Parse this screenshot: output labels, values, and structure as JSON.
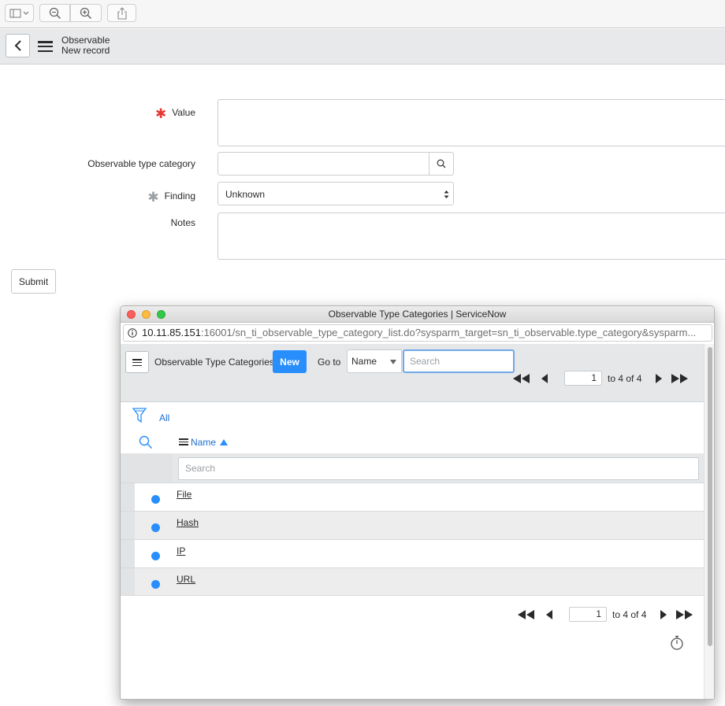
{
  "browser_toolbar": {
    "buttons": [
      "sidebar-toggle",
      "zoom-out",
      "zoom-in",
      "share"
    ]
  },
  "header": {
    "title": "Observable",
    "subtitle": "New record"
  },
  "form": {
    "value_label": "Value",
    "value_required_mark": "✱",
    "category_label": "Observable type category",
    "finding_label": "Finding",
    "finding_required_mark": "✱",
    "finding_selected": "Unknown",
    "notes_label": "Notes",
    "submit_label": "Submit"
  },
  "popup": {
    "window_title": "Observable Type Categories | ServiceNow",
    "url_host": "10.11.85.151",
    "url_rest": ":16001/sn_ti_observable_type_category_list.do?sysparm_target=sn_ti_observable.type_category&sysparm...",
    "list_title": "Observable Type Categories",
    "new_label": "New",
    "goto_label": "Go to",
    "goto_field": "Name",
    "search_placeholder": "Search",
    "filter_label": "All",
    "column_name": "Name",
    "column_search_placeholder": "Search",
    "pager": {
      "page_value": "1",
      "range_text": "to 4 of 4"
    },
    "rows": [
      {
        "name": "File"
      },
      {
        "name": "Hash"
      },
      {
        "name": "IP"
      },
      {
        "name": "URL"
      }
    ]
  },
  "colors": {
    "accent": "#278efc",
    "required": "#e53935",
    "header_bg": "#e7e9eb"
  }
}
